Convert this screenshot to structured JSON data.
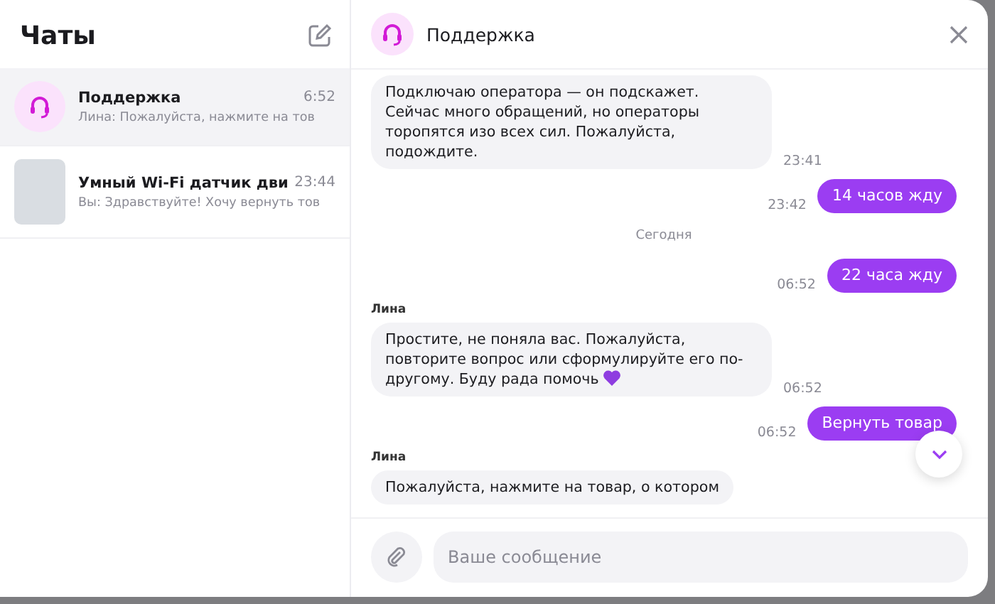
{
  "sidebar": {
    "title": "Чаты",
    "chats": [
      {
        "name": "Поддержка",
        "time": "6:52",
        "preview": "Лина: Пожалуйста, нажмите на тов",
        "kind": "support",
        "selected": true
      },
      {
        "name": "Умный Wi-Fi датчик дви",
        "time": "23:44",
        "preview": "Вы: Здравствуйте! Хочу вернуть тов",
        "kind": "product",
        "selected": false
      }
    ]
  },
  "chat": {
    "title": "Поддержка",
    "messages": [
      {
        "kind": "incoming",
        "text": "Подключаю оператора — он подскажет. Сейчас много обращений, но операторы торопятся изо всех сил. Пожалуйста, подождите.",
        "time": "23:41"
      },
      {
        "kind": "outgoing",
        "text": "14 часов жду",
        "time": "23:42"
      },
      {
        "kind": "date",
        "text": "Сегодня"
      },
      {
        "kind": "outgoing",
        "text": "22 часа жду",
        "time": "06:52"
      },
      {
        "kind": "incoming",
        "sender": "Лина",
        "text": "Простите, не поняла вас. Пожалуйста, повторите вопрос или сформулируйте его по-другому. Буду рада помочь",
        "heart": true,
        "time": "06:52"
      },
      {
        "kind": "outgoing",
        "text": "Вернуть товар",
        "time": "06:52"
      },
      {
        "kind": "incoming",
        "sender": "Лина",
        "text": "Пожалуйста, нажмите на товар, о котором"
      }
    ],
    "composer": {
      "placeholder": "Ваше сообщение"
    }
  }
}
